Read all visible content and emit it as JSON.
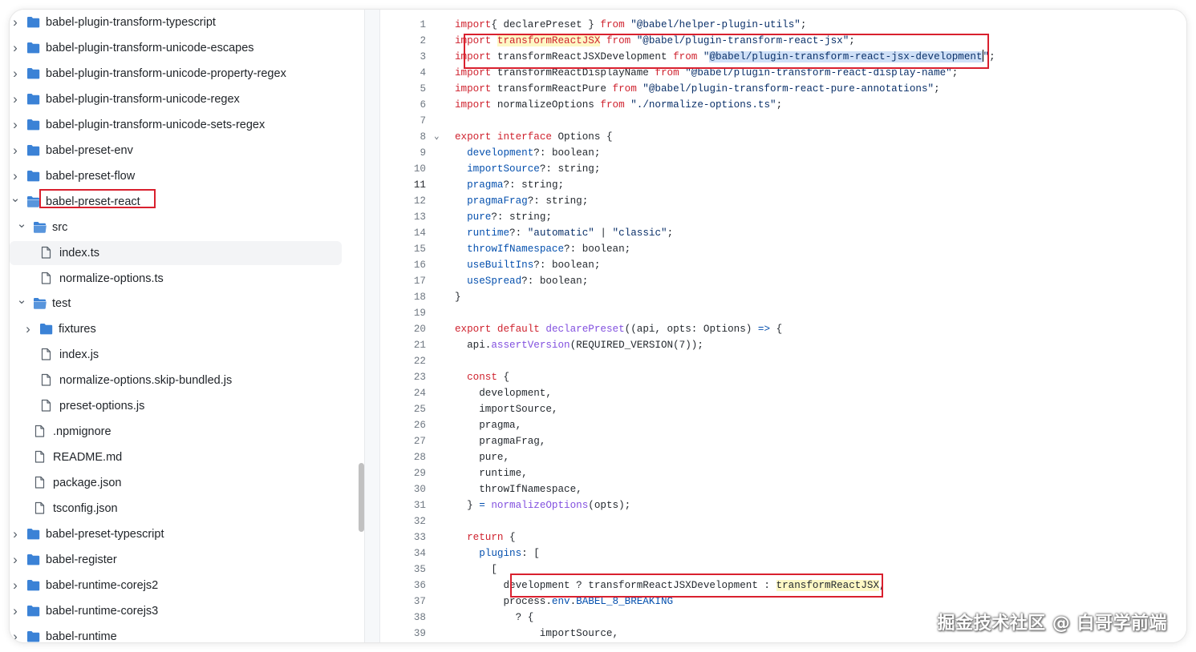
{
  "tree": {
    "items": [
      {
        "label": "babel-plugin-transform-typescript",
        "type": "folder",
        "chevron": "right",
        "depth": 0
      },
      {
        "label": "babel-plugin-transform-unicode-escapes",
        "type": "folder",
        "chevron": "right",
        "depth": 0
      },
      {
        "label": "babel-plugin-transform-unicode-property-regex",
        "type": "folder",
        "chevron": "right",
        "depth": 0
      },
      {
        "label": "babel-plugin-transform-unicode-regex",
        "type": "folder",
        "chevron": "right",
        "depth": 0
      },
      {
        "label": "babel-plugin-transform-unicode-sets-regex",
        "type": "folder",
        "chevron": "right",
        "depth": 0
      },
      {
        "label": "babel-preset-env",
        "type": "folder",
        "chevron": "right",
        "depth": 0
      },
      {
        "label": "babel-preset-flow",
        "type": "folder",
        "chevron": "right",
        "depth": 0
      },
      {
        "label": "babel-preset-react",
        "type": "folder-open",
        "chevron": "down",
        "depth": 0,
        "highlight": true
      },
      {
        "label": "src",
        "type": "folder-open",
        "chevron": "down",
        "depth": 1
      },
      {
        "label": "index.ts",
        "type": "file",
        "chevron": "none",
        "depth": 2,
        "selected": true
      },
      {
        "label": "normalize-options.ts",
        "type": "file",
        "chevron": "none",
        "depth": 2
      },
      {
        "label": "test",
        "type": "folder-open",
        "chevron": "down",
        "depth": 1
      },
      {
        "label": "fixtures",
        "type": "folder",
        "chevron": "right",
        "depth": 2
      },
      {
        "label": "index.js",
        "type": "file",
        "chevron": "none",
        "depth": 2
      },
      {
        "label": "normalize-options.skip-bundled.js",
        "type": "file",
        "chevron": "none",
        "depth": 2
      },
      {
        "label": "preset-options.js",
        "type": "file",
        "chevron": "none",
        "depth": 2
      },
      {
        "label": ".npmignore",
        "type": "file",
        "chevron": "none",
        "depth": 1
      },
      {
        "label": "README.md",
        "type": "file",
        "chevron": "none",
        "depth": 1
      },
      {
        "label": "package.json",
        "type": "file",
        "chevron": "none",
        "depth": 1
      },
      {
        "label": "tsconfig.json",
        "type": "file",
        "chevron": "none",
        "depth": 1
      },
      {
        "label": "babel-preset-typescript",
        "type": "folder",
        "chevron": "right",
        "depth": 0
      },
      {
        "label": "babel-register",
        "type": "folder",
        "chevron": "right",
        "depth": 0
      },
      {
        "label": "babel-runtime-corejs2",
        "type": "folder",
        "chevron": "right",
        "depth": 0
      },
      {
        "label": "babel-runtime-corejs3",
        "type": "folder",
        "chevron": "right",
        "depth": 0
      },
      {
        "label": "babel-runtime",
        "type": "folder",
        "chevron": "right",
        "depth": 0
      }
    ]
  },
  "editor": {
    "lines": [
      {
        "n": "1",
        "t": [
          [
            "kw",
            "import"
          ],
          [
            "",
            "{ declarePreset } "
          ],
          [
            "kw",
            "from"
          ],
          [
            "str",
            " \"@babel/helper-plugin-utils\""
          ],
          [
            "",
            ";"
          ]
        ]
      },
      {
        "n": "2",
        "t": [
          [
            "kw",
            "import "
          ],
          [
            "kw hl-y",
            "transformReactJSX"
          ],
          [
            "kw",
            " from"
          ],
          [
            "str",
            " \"@babel/plugin-transform-react-jsx\""
          ],
          [
            "",
            ";"
          ]
        ]
      },
      {
        "n": "3",
        "t": [
          [
            "kw",
            "import"
          ],
          [
            "",
            " transformReactJSXDevelopment "
          ],
          [
            "kw",
            "from"
          ],
          [
            "str",
            " \""
          ],
          [
            "str hl-sel",
            "@babel/plugin-transform-react-jsx-development"
          ],
          [
            "caret",
            ""
          ],
          [
            "str",
            "\""
          ],
          [
            "",
            ";"
          ]
        ]
      },
      {
        "n": "4",
        "t": [
          [
            "kw",
            "import"
          ],
          [
            "",
            " transformReactDisplayName "
          ],
          [
            "kw",
            "from"
          ],
          [
            "str",
            " \"@babel/plugin-transform-react-display-name\""
          ],
          [
            "",
            ";"
          ]
        ]
      },
      {
        "n": "5",
        "t": [
          [
            "kw",
            "import"
          ],
          [
            "",
            " transformReactPure "
          ],
          [
            "kw",
            "from"
          ],
          [
            "str",
            " \"@babel/plugin-transform-react-pure-annotations\""
          ],
          [
            "",
            ";"
          ]
        ]
      },
      {
        "n": "6",
        "t": [
          [
            "kw",
            "import"
          ],
          [
            "",
            " normalizeOptions "
          ],
          [
            "kw",
            "from"
          ],
          [
            "str",
            " \"./normalize-options.ts\""
          ],
          [
            "",
            ";"
          ]
        ]
      },
      {
        "n": "7",
        "t": []
      },
      {
        "n": "8",
        "fold": true,
        "t": [
          [
            "kw",
            "export"
          ],
          [
            "kw",
            " interface"
          ],
          [
            "",
            " Options {"
          ]
        ]
      },
      {
        "n": "9",
        "t": [
          [
            "",
            "  "
          ],
          [
            "prop",
            "development"
          ],
          [
            "",
            "?: boolean;"
          ]
        ]
      },
      {
        "n": "10",
        "t": [
          [
            "",
            "  "
          ],
          [
            "prop",
            "importSource"
          ],
          [
            "",
            "?: string;"
          ]
        ]
      },
      {
        "n": "11",
        "current": true,
        "t": [
          [
            "",
            "  "
          ],
          [
            "prop",
            "pragma"
          ],
          [
            "",
            "?: string;"
          ]
        ]
      },
      {
        "n": "12",
        "t": [
          [
            "",
            "  "
          ],
          [
            "prop",
            "pragmaFrag"
          ],
          [
            "",
            "?: string;"
          ]
        ]
      },
      {
        "n": "13",
        "t": [
          [
            "",
            "  "
          ],
          [
            "prop",
            "pure"
          ],
          [
            "",
            "?: string;"
          ]
        ]
      },
      {
        "n": "14",
        "t": [
          [
            "",
            "  "
          ],
          [
            "prop",
            "runtime"
          ],
          [
            "",
            "?: "
          ],
          [
            "str",
            "\"automatic\""
          ],
          [
            "",
            " | "
          ],
          [
            "str",
            "\"classic\""
          ],
          [
            "",
            ";"
          ]
        ]
      },
      {
        "n": "15",
        "t": [
          [
            "",
            "  "
          ],
          [
            "prop",
            "throwIfNamespace"
          ],
          [
            "",
            "?: boolean;"
          ]
        ]
      },
      {
        "n": "16",
        "t": [
          [
            "",
            "  "
          ],
          [
            "prop",
            "useBuiltIns"
          ],
          [
            "",
            "?: boolean;"
          ]
        ]
      },
      {
        "n": "17",
        "t": [
          [
            "",
            "  "
          ],
          [
            "prop",
            "useSpread"
          ],
          [
            "",
            "?: boolean;"
          ]
        ]
      },
      {
        "n": "18",
        "t": [
          [
            "",
            "}"
          ]
        ]
      },
      {
        "n": "19",
        "t": []
      },
      {
        "n": "20",
        "t": [
          [
            "kw",
            "export"
          ],
          [
            "kw",
            " default"
          ],
          [
            "fn",
            " declarePreset"
          ],
          [
            "",
            "((api, opts: Options) "
          ],
          [
            "prop",
            "=>"
          ],
          [
            "",
            " {"
          ]
        ]
      },
      {
        "n": "21",
        "t": [
          [
            "",
            "  api."
          ],
          [
            "fn",
            "assertVersion"
          ],
          [
            "",
            "(REQUIRED_VERSION(7));"
          ]
        ]
      },
      {
        "n": "22",
        "t": []
      },
      {
        "n": "23",
        "t": [
          [
            "",
            "  "
          ],
          [
            "kw",
            "const"
          ],
          [
            "",
            " {"
          ]
        ]
      },
      {
        "n": "24",
        "t": [
          [
            "",
            "    development,"
          ]
        ]
      },
      {
        "n": "25",
        "t": [
          [
            "",
            "    importSource,"
          ]
        ]
      },
      {
        "n": "26",
        "t": [
          [
            "",
            "    pragma,"
          ]
        ]
      },
      {
        "n": "27",
        "t": [
          [
            "",
            "    pragmaFrag,"
          ]
        ]
      },
      {
        "n": "28",
        "t": [
          [
            "",
            "    pure,"
          ]
        ]
      },
      {
        "n": "29",
        "t": [
          [
            "",
            "    runtime,"
          ]
        ]
      },
      {
        "n": "30",
        "t": [
          [
            "",
            "    throwIfNamespace,"
          ]
        ]
      },
      {
        "n": "31",
        "t": [
          [
            "",
            "  } "
          ],
          [
            "prop",
            "="
          ],
          [
            "fn",
            " normalizeOptions"
          ],
          [
            "",
            "(opts);"
          ]
        ]
      },
      {
        "n": "32",
        "t": []
      },
      {
        "n": "33",
        "t": [
          [
            "",
            "  "
          ],
          [
            "kw",
            "return"
          ],
          [
            "",
            " {"
          ]
        ]
      },
      {
        "n": "34",
        "t": [
          [
            "",
            "    "
          ],
          [
            "prop",
            "plugins"
          ],
          [
            "",
            ": ["
          ]
        ]
      },
      {
        "n": "35",
        "t": [
          [
            "",
            "      ["
          ]
        ]
      },
      {
        "n": "36",
        "t": [
          [
            "",
            "        development ? transformReactJSXDevelopment : "
          ],
          [
            "hl-y",
            "transformReactJSX"
          ],
          [
            "",
            ","
          ]
        ]
      },
      {
        "n": "37",
        "t": [
          [
            "",
            "        process."
          ],
          [
            "prop",
            "env"
          ],
          [
            "",
            "."
          ],
          [
            "prop",
            "BABEL_8_BREAKING"
          ]
        ]
      },
      {
        "n": "38",
        "t": [
          [
            "",
            "          ? {"
          ]
        ]
      },
      {
        "n": "39",
        "t": [
          [
            "",
            "              importSource,"
          ]
        ]
      }
    ]
  },
  "watermark": "掘金技术社区 @ 白哥学前端",
  "colors": {
    "highlight_box": "#d9202e",
    "folder": "#3b82d6",
    "keyword": "#cf222e",
    "string": "#0a3069",
    "property": "#0550ae"
  }
}
